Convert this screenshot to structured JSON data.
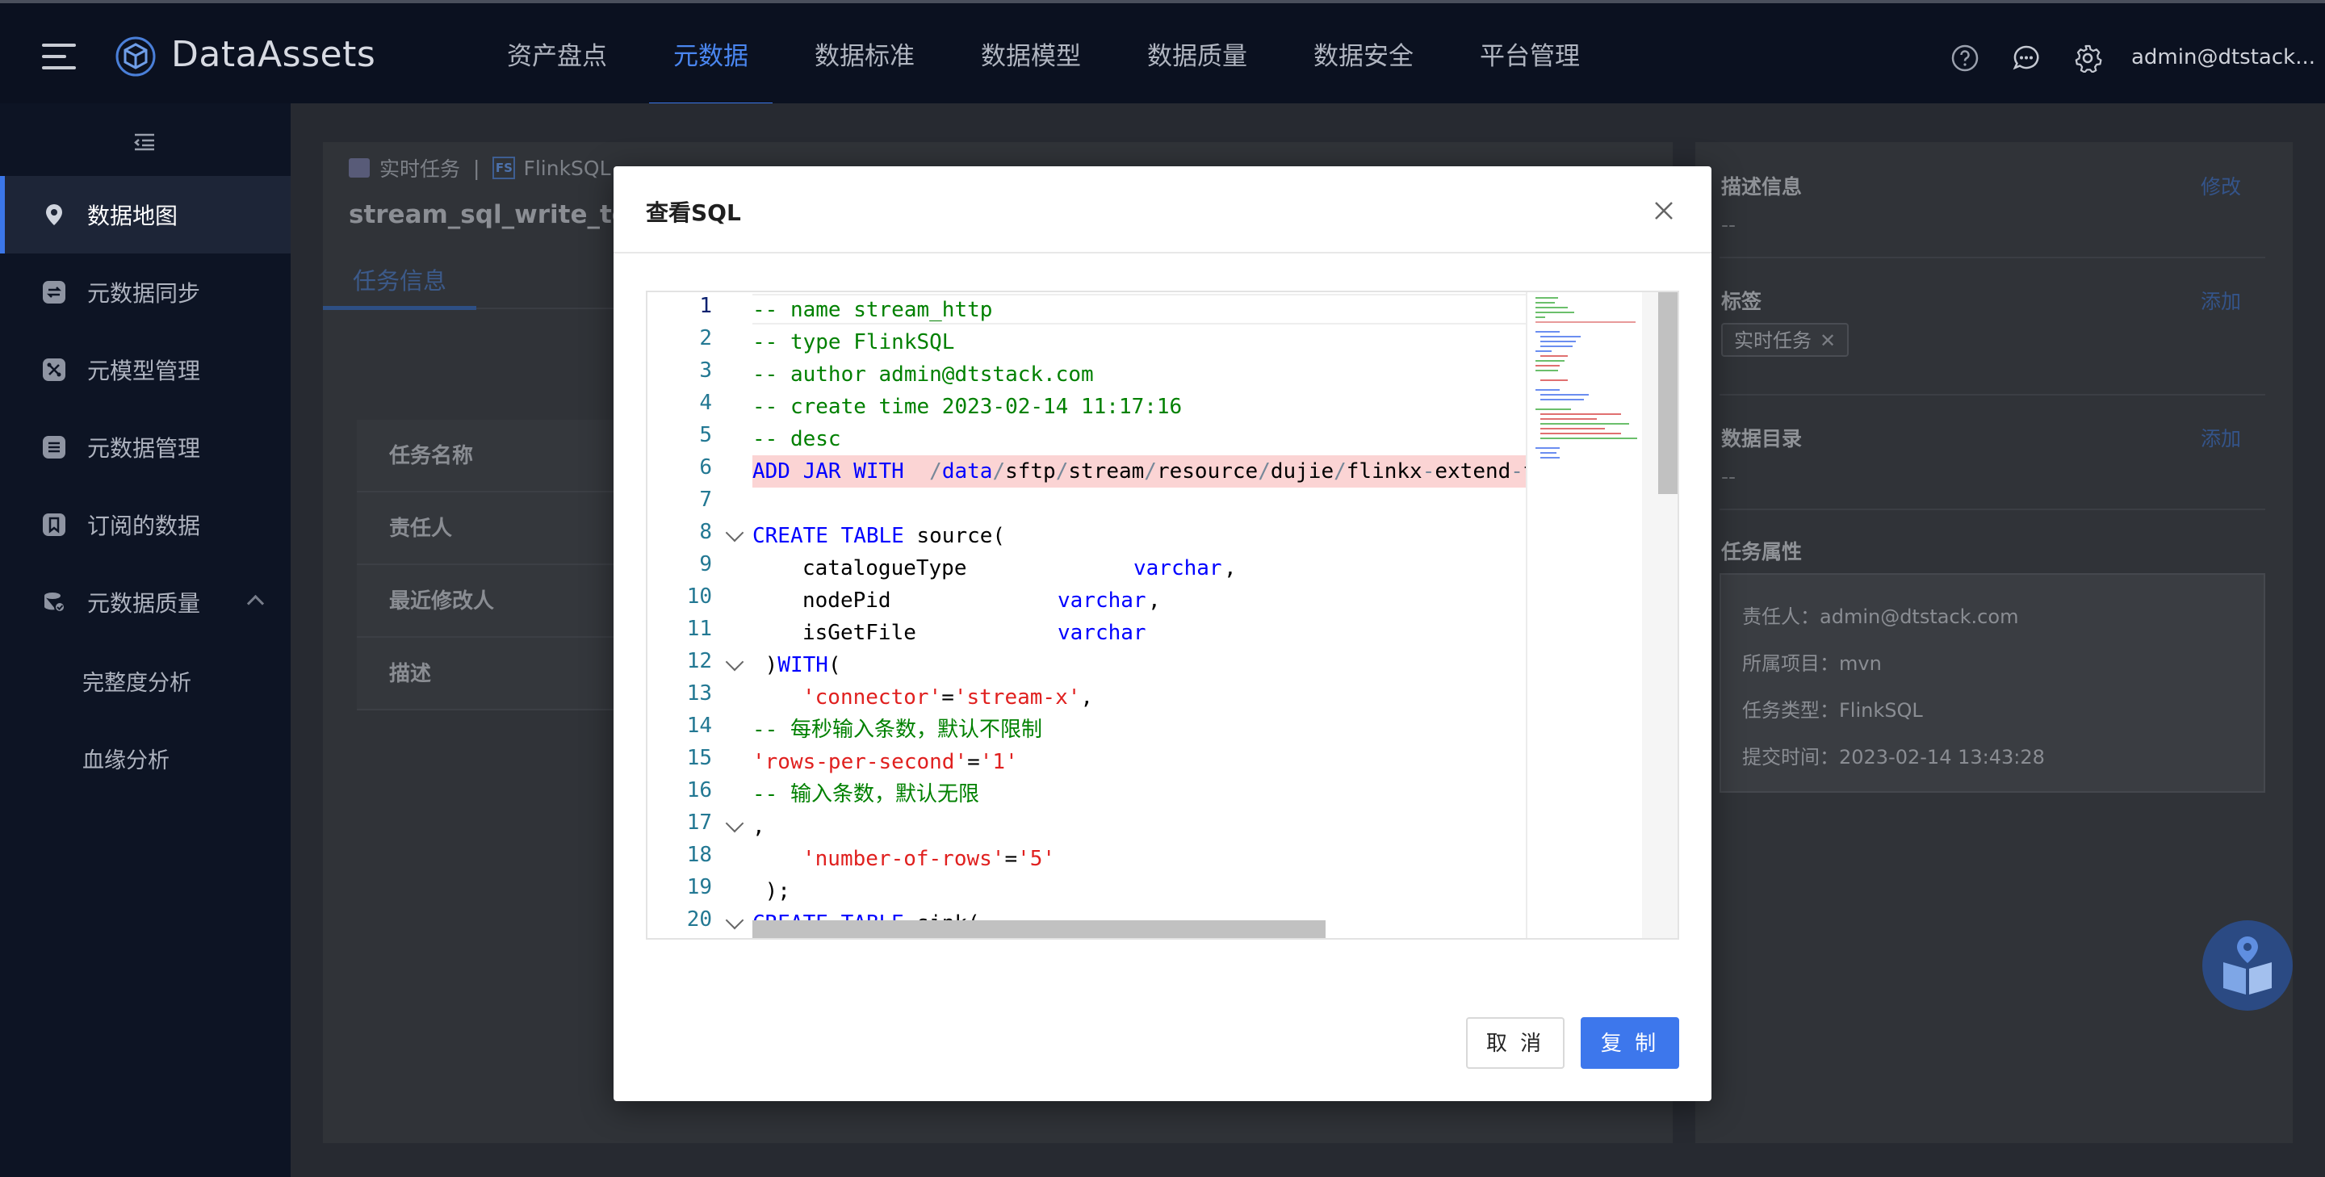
{
  "app": {
    "brand": "DataAssets",
    "user": "admin@dtstack..."
  },
  "nav": {
    "items": [
      {
        "label": "资产盘点",
        "active": false
      },
      {
        "label": "元数据",
        "active": true
      },
      {
        "label": "数据标准",
        "active": false
      },
      {
        "label": "数据模型",
        "active": false
      },
      {
        "label": "数据质量",
        "active": false
      },
      {
        "label": "数据安全",
        "active": false
      },
      {
        "label": "平台管理",
        "active": false
      }
    ]
  },
  "sidebar": {
    "items": [
      {
        "label": "数据地图",
        "icon": "map-pin-icon",
        "active": true
      },
      {
        "label": "元数据同步",
        "icon": "sync-icon",
        "active": false
      },
      {
        "label": "元模型管理",
        "icon": "model-icon",
        "active": false
      },
      {
        "label": "元数据管理",
        "icon": "database-icon",
        "active": false
      },
      {
        "label": "订阅的数据",
        "icon": "bookmark-icon",
        "active": false
      },
      {
        "label": "元数据质量",
        "icon": "quality-icon",
        "active": false
      }
    ],
    "sub_items": [
      "完整度分析",
      "血缘分析"
    ]
  },
  "page": {
    "breadcrumb": [
      "实时任务",
      "FlinkSQL"
    ],
    "title": "stream_sql_write_ten",
    "tab": "任务信息",
    "table_labels": [
      "任务名称",
      "责任人",
      "最近修改人",
      "描述"
    ]
  },
  "right_panel": {
    "desc_title": "描述信息",
    "desc_action": "修改",
    "desc_value": "--",
    "tag_title": "标签",
    "tag_action": "添加",
    "tag_value": "实时任务",
    "catalog_title": "数据目录",
    "catalog_action": "添加",
    "catalog_value": "--",
    "attr_title": "任务属性",
    "attrs": [
      "责任人：admin@dtstack.com",
      "所属项目：mvn",
      "任务类型：FlinkSQL",
      "提交时间：2023-02-14 13:43:28"
    ]
  },
  "modal": {
    "title": "查看SQL",
    "cancel_label": "取 消",
    "copy_label": "复 制",
    "line_numbers": [
      "1",
      "2",
      "3",
      "4",
      "5",
      "6",
      "7",
      "8",
      "9",
      "10",
      "11",
      "12",
      "13",
      "14",
      "15",
      "16",
      "17",
      "18",
      "19",
      "20"
    ],
    "code": {
      "l1": "-- name stream_http",
      "l2": "-- type FlinkSQL",
      "l3": "-- author admin@dtstack.com",
      "l4": "-- create time 2023-02-14 11:17:16",
      "l5": "-- desc",
      "l6_kw": "ADD JAR WITH",
      "l6_p0": "/",
      "l6_p1": "data",
      "l6_p2": "/",
      "l6_p3": "sftp",
      "l6_p4": "/",
      "l6_p5": "stream",
      "l6_p6": "/",
      "l6_p7": "resource",
      "l6_p8": "/",
      "l6_p9": "dujie",
      "l6_p10": "/",
      "l6_p11": "flinkx",
      "l6_p12": "-",
      "l6_p13": "extend",
      "l6_p14": "-",
      "l6_p15": "te",
      "l8_kw": "CREATE TABLE",
      "l8_rest": " source(",
      "l9_name": "catalogueType",
      "l9_type": "varchar",
      "l9_tail": ",",
      "l10_name": "nodePid",
      "l10_type": "varchar",
      "l10_tail": ",",
      "l11_name": "isGetFile",
      "l11_type": "varchar",
      "l12_a": " )",
      "l12_kw": "WITH",
      "l12_b": "(",
      "l13_a": "'connector'",
      "l13_eq": "=",
      "l13_b": "'stream-x'",
      "l13_tail": ",",
      "l14": "-- 每秒输入条数，默认不限制",
      "l15_a": "'rows-per-second'",
      "l15_eq": "=",
      "l15_b": "'1'",
      "l16": "-- 输入条数，默认无限",
      "l17": ",",
      "l18_a": "'number-of-rows'",
      "l18_eq": "=",
      "l18_b": "'5'",
      "l19": " );",
      "l20_kw": "CREATE TABLE",
      "l20_rest": " sink("
    }
  }
}
